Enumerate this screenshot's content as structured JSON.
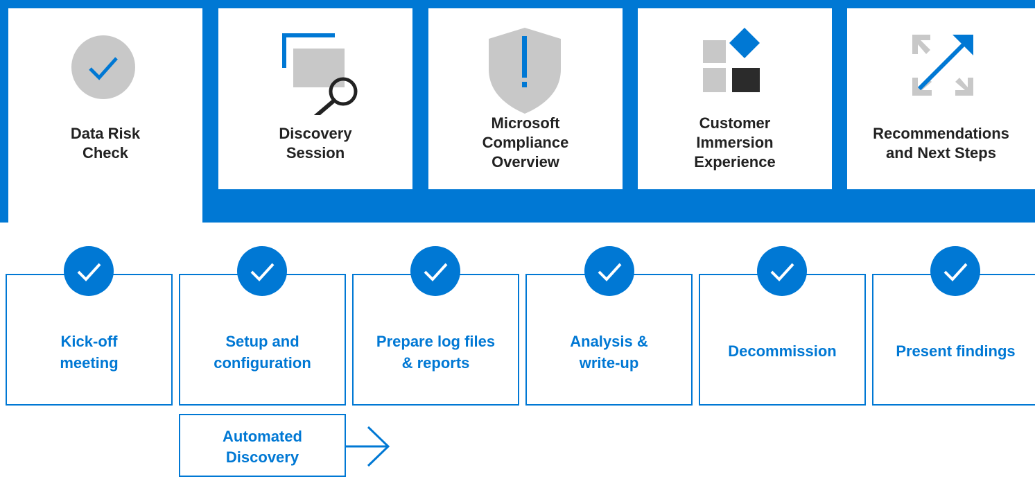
{
  "phases": [
    {
      "label": "Data Risk\nCheck",
      "icon": "checkmark-circle-icon"
    },
    {
      "label": "Discovery\nSession",
      "icon": "magnifier-windows-icon"
    },
    {
      "label": "Microsoft\nCompliance\nOverview",
      "icon": "shield-exclamation-icon"
    },
    {
      "label": "Customer\nImmersion\nExperience",
      "icon": "tiles-diamond-icon"
    },
    {
      "label": "Recommendations\nand Next Steps",
      "icon": "expand-arrows-icon"
    }
  ],
  "steps": [
    {
      "label": "Kick-off\nmeeting"
    },
    {
      "label": "Setup and\nconfiguration"
    },
    {
      "label": "Prepare log files\n& reports"
    },
    {
      "label": "Analysis &\nwrite-up"
    },
    {
      "label": "Decommission"
    },
    {
      "label": "Present findings"
    }
  ],
  "automated": {
    "label": "Automated\nDiscovery",
    "icon": "arrow-right-icon"
  },
  "colors": {
    "accent": "#0078d4",
    "gray": "#c8c8c8",
    "dark": "#2b2b2b"
  }
}
